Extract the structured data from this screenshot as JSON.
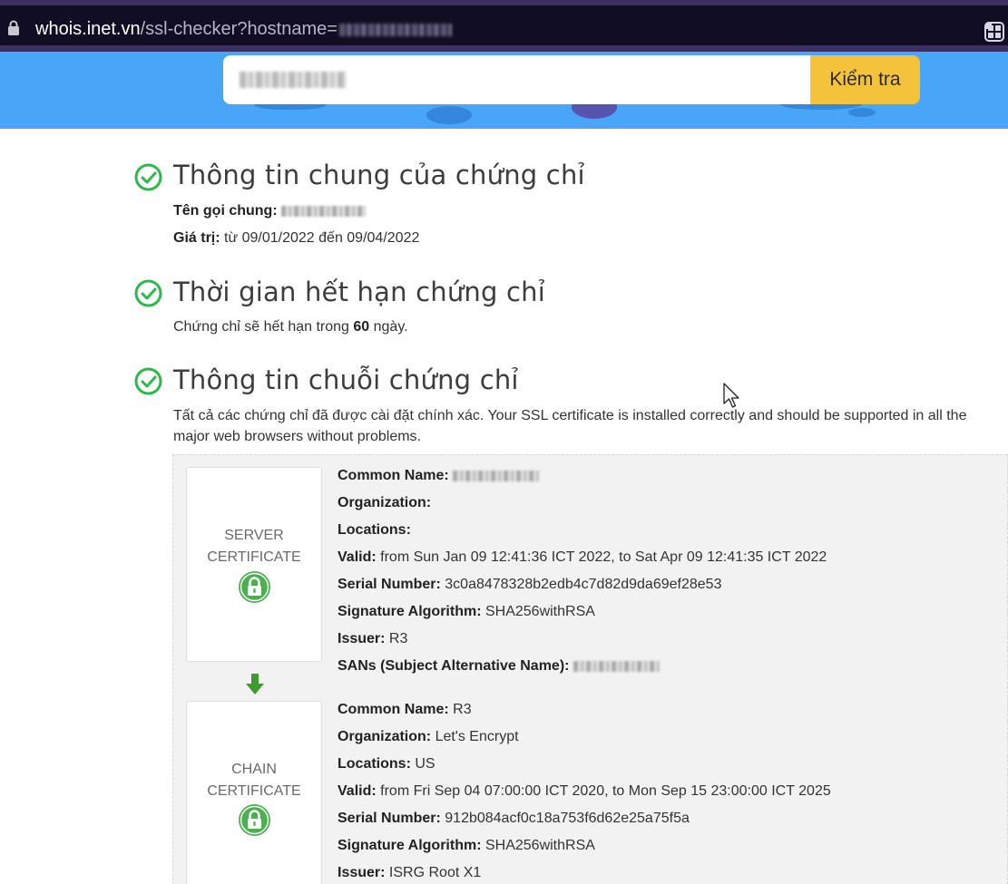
{
  "browser": {
    "url_host": "whois.inet.vn",
    "url_path": "/ssl-checker?hostname="
  },
  "search": {
    "button_label": "Kiểm tra"
  },
  "general": {
    "title": "Thông tin chung của chứng chỉ",
    "common_name_label": "Tên gọi chung:",
    "validity_label": "Giá trị:",
    "validity_value": "từ 09/01/2022 đến 09/04/2022"
  },
  "expiry": {
    "title": "Thời gian hết hạn chứng chỉ",
    "text_before": "Chứng chỉ sẽ hết hạn trong ",
    "days": "60",
    "text_after": " ngày."
  },
  "chain": {
    "title": "Thông tin chuỗi chứng chỉ",
    "description_line1": "Tất cả các chứng chỉ đã được cài đặt chính xác. Your SSL certificate is installed correctly and should be supported in all the",
    "description_line2": "major web browsers without problems.",
    "labels": {
      "common_name": "Common Name:",
      "organization": "Organization:",
      "locations": "Locations:",
      "valid": "Valid:",
      "serial": "Serial Number:",
      "sig_alg": "Signature Algorithm:",
      "issuer": "Issuer:",
      "sans": "SANs (Subject Alternative Name):"
    },
    "server": {
      "card_line1": "SERVER",
      "card_line2": "CERTIFICATE",
      "organization": "",
      "locations": "",
      "valid": "from Sun Jan 09 12:41:36 ICT 2022, to Sat Apr 09 12:41:35 ICT 2022",
      "serial": "3c0a8478328b2edb4c7d82d9da69ef28e53",
      "sig_alg": "SHA256withRSA",
      "issuer": "R3"
    },
    "intermediate": {
      "card_line1": "CHAIN",
      "card_line2": "CERTIFICATE",
      "common_name": "R3",
      "organization": "Let's Encrypt",
      "locations": "US",
      "valid": "from Fri Sep 04 07:00:00 ICT 2020, to Mon Sep 15 23:00:00 ICT 2025",
      "serial": "912b084acf0c18a753f6d62e25a75f5a",
      "sig_alg": "SHA256withRSA",
      "issuer": "ISRG Root X1"
    }
  },
  "colors": {
    "check_green": "#2db84d",
    "lock_green": "#4caf50",
    "arrow_green": "#3f9b2f",
    "hero_blue": "#48a5f7",
    "button_yellow": "#f5c33b"
  },
  "icons": [
    "lock-icon",
    "extensions-icon",
    "check-circle-icon",
    "padlock-icon",
    "arrow-down-icon",
    "mouse-cursor-icon"
  ]
}
